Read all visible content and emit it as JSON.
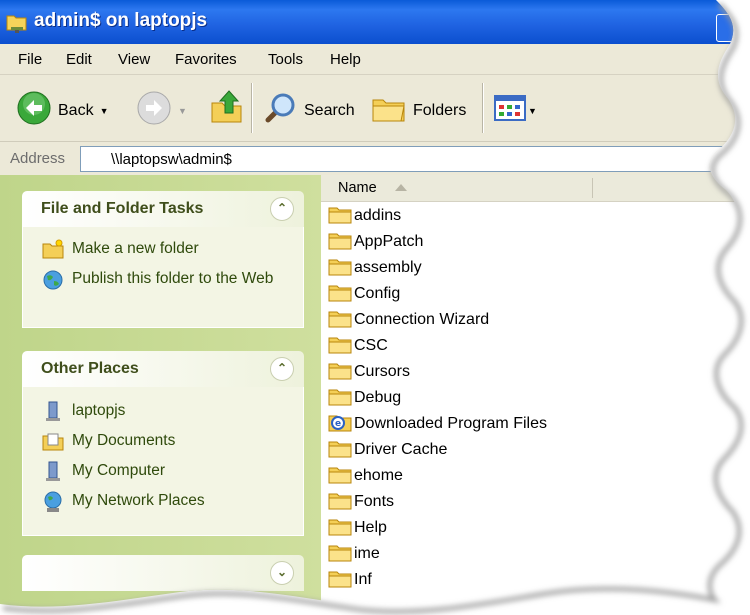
{
  "window": {
    "title": "admin$ on laptopjs"
  },
  "menu": [
    "File",
    "Edit",
    "View",
    "Favorites",
    "Tools",
    "Help"
  ],
  "toolbar": {
    "back": "Back",
    "search": "Search",
    "folders": "Folders"
  },
  "address": {
    "label": "Address",
    "value": "\\\\laptopsw\\admin$"
  },
  "left_pane": {
    "file_tasks": {
      "title": "File and Folder Tasks",
      "items": [
        "Make a new folder",
        "Publish this folder to the Web"
      ]
    },
    "other_places": {
      "title": "Other Places",
      "items": [
        "laptopjs",
        "My Documents",
        "My Computer",
        "My Network Places"
      ]
    }
  },
  "list": {
    "column_name": "Name",
    "files": [
      "addins",
      "AppPatch",
      "assembly",
      "Config",
      "Connection Wizard",
      "CSC",
      "Cursors",
      "Debug",
      "Downloaded Program Files",
      "Driver Cache",
      "ehome",
      "Fonts",
      "Help",
      "ime",
      "Inf"
    ]
  }
}
